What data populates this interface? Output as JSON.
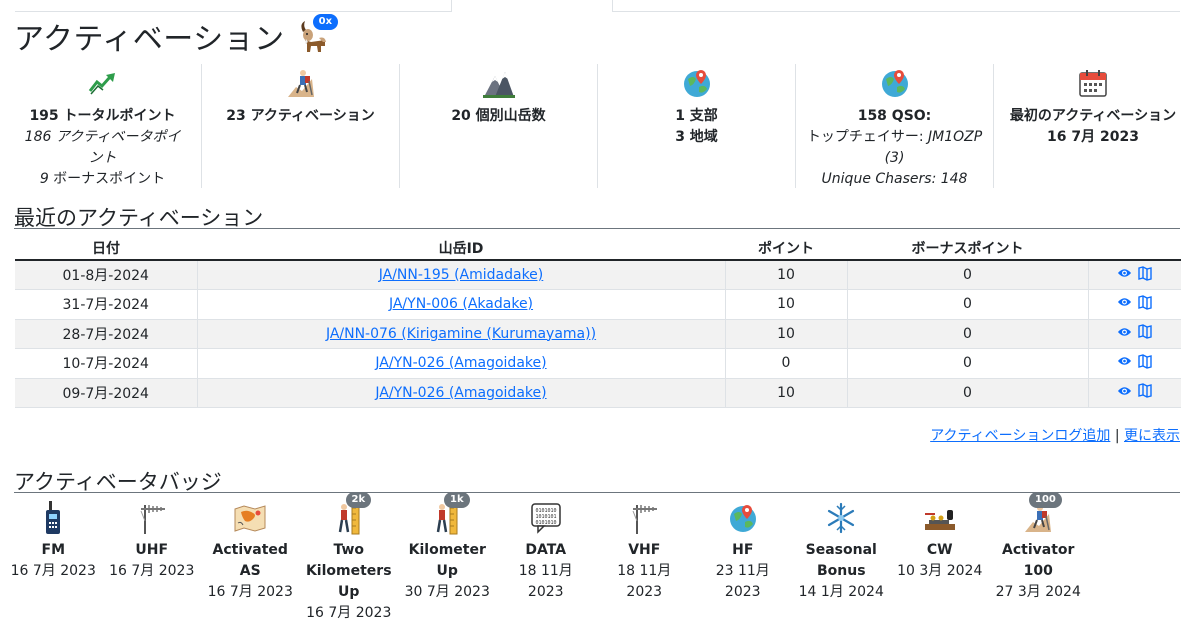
{
  "page": {
    "title": "アクティベーション",
    "title_badge": "0x"
  },
  "stats": [
    {
      "icon": "trending-up-icon",
      "lines": [
        "195 トータルポイント"
      ],
      "sub": [
        "186 アクティベータポイント",
        "9 ボーナスポイント"
      ]
    },
    {
      "icon": "hiker-icon",
      "lines": [
        "23 アクティベーション"
      ],
      "sub": []
    },
    {
      "icon": "mountain-icon",
      "lines": [
        "20 個別山岳数"
      ],
      "sub": []
    },
    {
      "icon": "globe-pin-icon",
      "lines": [
        "1 支部",
        "3 地域"
      ],
      "sub": []
    },
    {
      "icon": "globe-pin-icon",
      "lines": [
        "158 QSO:"
      ],
      "sub": [
        "トップチェイサー: JM1OZP",
        "(3)",
        "Unique Chasers: 148"
      ]
    },
    {
      "icon": "calendar-icon",
      "lines": [
        "最初のアクティベーション",
        "16 7月 2023"
      ],
      "sub": []
    }
  ],
  "recent": {
    "heading": "最近のアクティベーション",
    "columns": [
      "日付",
      "山岳ID",
      "ポイント",
      "ボーナスポイント"
    ],
    "rows": [
      {
        "date": "01-8月-2024",
        "summit": "JA/NN-195 (Amidadake)",
        "points": "10",
        "bonus": "0"
      },
      {
        "date": "31-7月-2024",
        "summit": "JA/YN-006 (Akadake)",
        "points": "10",
        "bonus": "0"
      },
      {
        "date": "28-7月-2024",
        "summit": "JA/NN-076 (Kirigamine (Kurumayama))",
        "points": "10",
        "bonus": "0"
      },
      {
        "date": "10-7月-2024",
        "summit": "JA/YN-026 (Amagoidake)",
        "points": "0",
        "bonus": "0"
      },
      {
        "date": "09-7月-2024",
        "summit": "JA/YN-026 (Amagoidake)",
        "points": "10",
        "bonus": "0"
      }
    ],
    "add_log": "アクティベーションログ追加",
    "separator": "|",
    "more": "更に表示"
  },
  "badges_section": {
    "heading": "アクティベータバッジ",
    "badges": [
      {
        "icon": "radio-icon",
        "name": [
          "FM"
        ],
        "date": [
          "16 7月 2023"
        ],
        "count": ""
      },
      {
        "icon": "antenna-icon",
        "name": [
          "UHF"
        ],
        "date": [
          "16 7月 2023"
        ],
        "count": ""
      },
      {
        "icon": "map-asia-icon",
        "name": [
          "Activated",
          "AS"
        ],
        "date": [
          "16 7月 2023"
        ],
        "count": ""
      },
      {
        "icon": "climber-ruler-icon",
        "name": [
          "Two",
          "Kilometers",
          "Up"
        ],
        "date": [
          "16 7月 2023"
        ],
        "count": "2k"
      },
      {
        "icon": "climber-ruler-icon",
        "name": [
          "Kilometer",
          "Up"
        ],
        "date": [
          "30 7月 2023"
        ],
        "count": "1k"
      },
      {
        "icon": "data-chat-icon",
        "name": [
          "DATA"
        ],
        "date": [
          "18 11月",
          "2023"
        ],
        "count": ""
      },
      {
        "icon": "antenna-icon",
        "name": [
          "VHF"
        ],
        "date": [
          "18 11月",
          "2023"
        ],
        "count": ""
      },
      {
        "icon": "globe-pin-icon",
        "name": [
          "HF"
        ],
        "date": [
          "23 11月",
          "2023"
        ],
        "count": ""
      },
      {
        "icon": "snowflake-icon",
        "name": [
          "Seasonal",
          "Bonus"
        ],
        "date": [
          "14 1月 2024"
        ],
        "count": ""
      },
      {
        "icon": "morse-key-icon",
        "name": [
          "CW"
        ],
        "date": [
          "10 3月 2024"
        ],
        "count": ""
      },
      {
        "icon": "hiker-icon",
        "name": [
          "Activator",
          "100"
        ],
        "date": [
          "27 3月 2024"
        ],
        "count": "100"
      }
    ]
  },
  "colors": {
    "link": "#0d6efd",
    "badge_primary": "#0d6efd",
    "badge_secondary": "#6c757d",
    "stripe": "#f2f2f2"
  }
}
